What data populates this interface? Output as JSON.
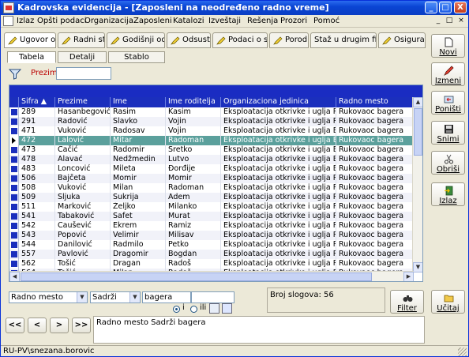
{
  "window": {
    "title": "Kadrovska evidencija - [Zaposleni na neodređeno radno vreme]",
    "controls": [
      "_",
      "□",
      "X"
    ]
  },
  "menu": {
    "items": [
      "Izlaz",
      "Opšti podaci",
      "Organizacija",
      "Zaposleni",
      "Katalozi",
      "Izveštaji",
      "Rešenja",
      "Prozori",
      "Pomoć"
    ],
    "mdi_controls": [
      "_",
      "□",
      "×"
    ]
  },
  "tabs": [
    "Ugovor o radu",
    "Radni staž",
    "Godišnji odmor",
    "Odsustva",
    "Podaci o struci",
    "Porodica",
    "Staž u drugim firmama",
    "Osiguranje"
  ],
  "subtabs": [
    "Tabela",
    "Detalji",
    "Stablo"
  ],
  "filter": {
    "label": "Prezime",
    "value": ""
  },
  "grid": {
    "columns": [
      "Šifra",
      "Prezime",
      "Ime",
      "Ime roditelja",
      "Organizaciona jedinica",
      "Radno mesto"
    ],
    "rows": [
      [
        "289",
        "Hasanbegović",
        "Rasim",
        "Kasim",
        "Eksploatacija otkrivke i uglja Potrlica",
        "Rukovaoc bagera"
      ],
      [
        "291",
        "Radović",
        "Slavko",
        "Vojin",
        "Eksploatacija otkrivke i uglja Potrlica",
        "Rukovaoc bagera"
      ],
      [
        "471",
        "Vuković",
        "Radosav",
        "Vojin",
        "Eksploatacija otkrivke i uglja Borovica",
        "Rukovaoc bagera"
      ],
      [
        "472",
        "Lalović",
        "Mitar",
        "Radoman",
        "Eksploatacija otkrivke i uglja Borovica",
        "Rukovaoc bagera"
      ],
      [
        "473",
        "Čačić",
        "Radomir",
        "Sretko",
        "Eksploatacija otkrivke i uglja Borovica",
        "Rukovaoc bagera"
      ],
      [
        "478",
        "Alavać",
        "Nedžmedin",
        "Lutvo",
        "Eksploatacija otkrivke i uglja Borovica",
        "Rukovaoc bagera"
      ],
      [
        "483",
        "Loncović",
        "Mileta",
        "Đorđije",
        "Eksploatacija otkrivke i uglja Borovica",
        "Rukovaoc bagera"
      ],
      [
        "506",
        "Bajčeta",
        "Momir",
        "Momir",
        "Eksploatacija otkrivke i uglja Potrlica",
        "Rukovaoc bagera"
      ],
      [
        "508",
        "Vuković",
        "Milan",
        "Radoman",
        "Eksploatacija otkrivke i uglja Potrlica",
        "Rukovaoc bagera"
      ],
      [
        "509",
        "Šljuka",
        "Šukrija",
        "Adem",
        "Eksploatacija otkrivke i uglja Potrlica",
        "Rukovaoc bagera"
      ],
      [
        "511",
        "Marković",
        "Željko",
        "Milanko",
        "Eksploatacija otkrivke i uglja Potrlica",
        "Rukovaoc bagera"
      ],
      [
        "541",
        "Tabaković",
        "Safet",
        "Murat",
        "Eksploatacija otkrivke i uglja Potrlica",
        "Rukovaoc bagera"
      ],
      [
        "542",
        "Čaušević",
        "Ekrem",
        "Ramiz",
        "Eksploatacija otkrivke i uglja Potrlica",
        "Rukovaoc bagera"
      ],
      [
        "543",
        "Popović",
        "Velimir",
        "Milisav",
        "Eksploatacija otkrivke i uglja Potrlica",
        "Rukovaoc bagera"
      ],
      [
        "544",
        "Danilović",
        "Radmilo",
        "Petko",
        "Eksploatacija otkrivke i uglja Potrlica",
        "Rukovaoc bagera"
      ],
      [
        "557",
        "Pavlović",
        "Dragomir",
        "Bogdan",
        "Eksploatacija otkrivke i uglja Potrlica",
        "Rukovaoc bagera"
      ],
      [
        "562",
        "Tošić",
        "Dragan",
        "Radoš",
        "Eksploatacija otkrivke i uglja Potrlica",
        "Rukovaoc bagera"
      ],
      [
        "564",
        "Tošić",
        "Milan",
        "Radoš",
        "Eksploatacija otkrivke i uglja Potrlica",
        "Rukovaoc bagera"
      ]
    ],
    "selected_code": "472"
  },
  "side_buttons": [
    "Novi",
    "Izmeni",
    "Poništi",
    "Snimi",
    "Obriši",
    "Izlaz"
  ],
  "search": {
    "field": "Radno mesto",
    "operator": "Sadrži",
    "value": "bagera",
    "radio_i": "i",
    "radio_ili": "ili"
  },
  "record_count": "Broj slogova: 56",
  "filter_button": "Filter",
  "load_button": "Učitaj",
  "nav_buttons": [
    "<<",
    "<",
    ">",
    ">>"
  ],
  "status_filter_text": "Radno mesto Sadrži bagera",
  "statusbar": "RU-PV\\snezana.borovic",
  "colors": {
    "title": "#0a45d4",
    "grid_header": "#1b2fbd",
    "selected_row": "#5ba09c"
  }
}
